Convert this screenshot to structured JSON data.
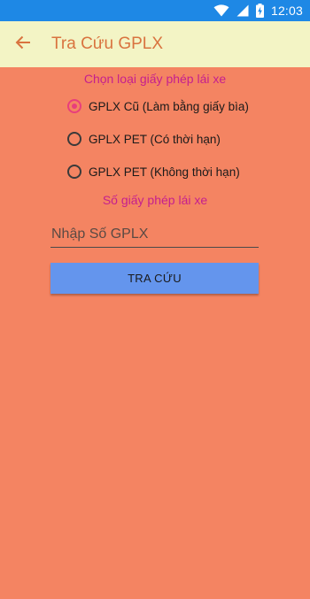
{
  "status_bar": {
    "time": "12:03",
    "icons": [
      "wifi-icon",
      "signal-icon",
      "battery-charging-icon"
    ]
  },
  "app_bar": {
    "title": "Tra Cứu GPLX",
    "back_icon": "arrow-left-icon"
  },
  "form": {
    "license_type_label": "Chọn loại giấy phép lái xe",
    "options": [
      {
        "label": "GPLX Cũ (Làm bằng giấy bìa)",
        "checked": true
      },
      {
        "label": "GPLX PET (Có thời hạn)",
        "checked": false
      },
      {
        "label": "GPLX PET (Không thời hạn)",
        "checked": false
      }
    ],
    "license_number_label": "Số giấy phép lái xe",
    "license_number_placeholder": "Nhập Số GPLX",
    "license_number_value": "",
    "search_button_label": "TRA CỨU"
  },
  "colors": {
    "status_bar": "#1E88E5",
    "app_bar": "#F3F4C5",
    "title": "#D9733F",
    "background": "#F48462",
    "section_label": "#C51F8E",
    "radio_checked": "#E83E7C",
    "button": "#6495ED"
  }
}
